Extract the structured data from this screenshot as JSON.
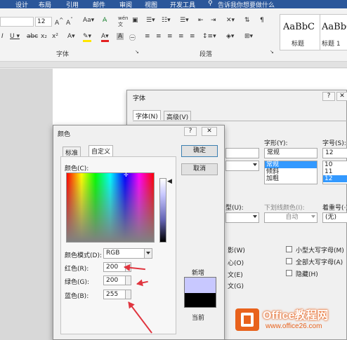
{
  "menubar": {
    "items": [
      "设计",
      "布局",
      "引用",
      "邮件",
      "审阅",
      "视图",
      "开发工具"
    ],
    "search_hint": "告诉我你想要做什么"
  },
  "ribbon": {
    "font_size": "12",
    "styles": [
      {
        "preview": "AaBbC",
        "name": "标题"
      },
      {
        "preview": "AaBbC",
        "name": "标题 1"
      }
    ],
    "group_font": "字体",
    "group_paragraph": "段落"
  },
  "font_dialog": {
    "title": "字体",
    "tabs": [
      "字体(N)",
      "高级(V)"
    ],
    "style_label": "字形(Y):",
    "style_value": "常规",
    "style_options": [
      "常规",
      "倾斜",
      "加粗"
    ],
    "size_label": "字号(S):",
    "size_value": "12",
    "size_options": [
      "10",
      "11",
      "12"
    ],
    "underline_label": "下划线颜色(I):",
    "underline_value": "自动",
    "emphasis_label": "着重号(·);",
    "emphasis_value": "(无)",
    "type_fragment": "型(U):",
    "effects": {
      "small_caps": "小型大写字母(M)",
      "all_caps": "全部大写字母(A)",
      "hidden": "隐藏(H)",
      "frag_shadow": "影(W)",
      "frag_hollow": "心(O)",
      "frag_emboss": "文(E)",
      "frag_engrave": "文(G)"
    }
  },
  "color_dialog": {
    "title": "颜色",
    "tabs": [
      "标准",
      "自定义"
    ],
    "active_tab": "自定义",
    "colors_label": "颜色(C):",
    "model_label": "颜色模式(D):",
    "model_value": "RGB",
    "red_label": "红色(R):",
    "red_value": "200",
    "green_label": "绿色(G):",
    "green_value": "200",
    "blue_label": "蓝色(B):",
    "blue_value": "255",
    "ok_label": "确定",
    "cancel_label": "取消",
    "new_label": "新增",
    "current_label": "当前",
    "new_color": "#c8c8ff",
    "current_color": "#000000"
  },
  "watermark": {
    "title": "Office教程网",
    "url": "www.office26.com"
  },
  "colors": {
    "word_blue": "#2b579a",
    "arrow_red": "#e0353f",
    "office_orange": "#e8621c"
  }
}
